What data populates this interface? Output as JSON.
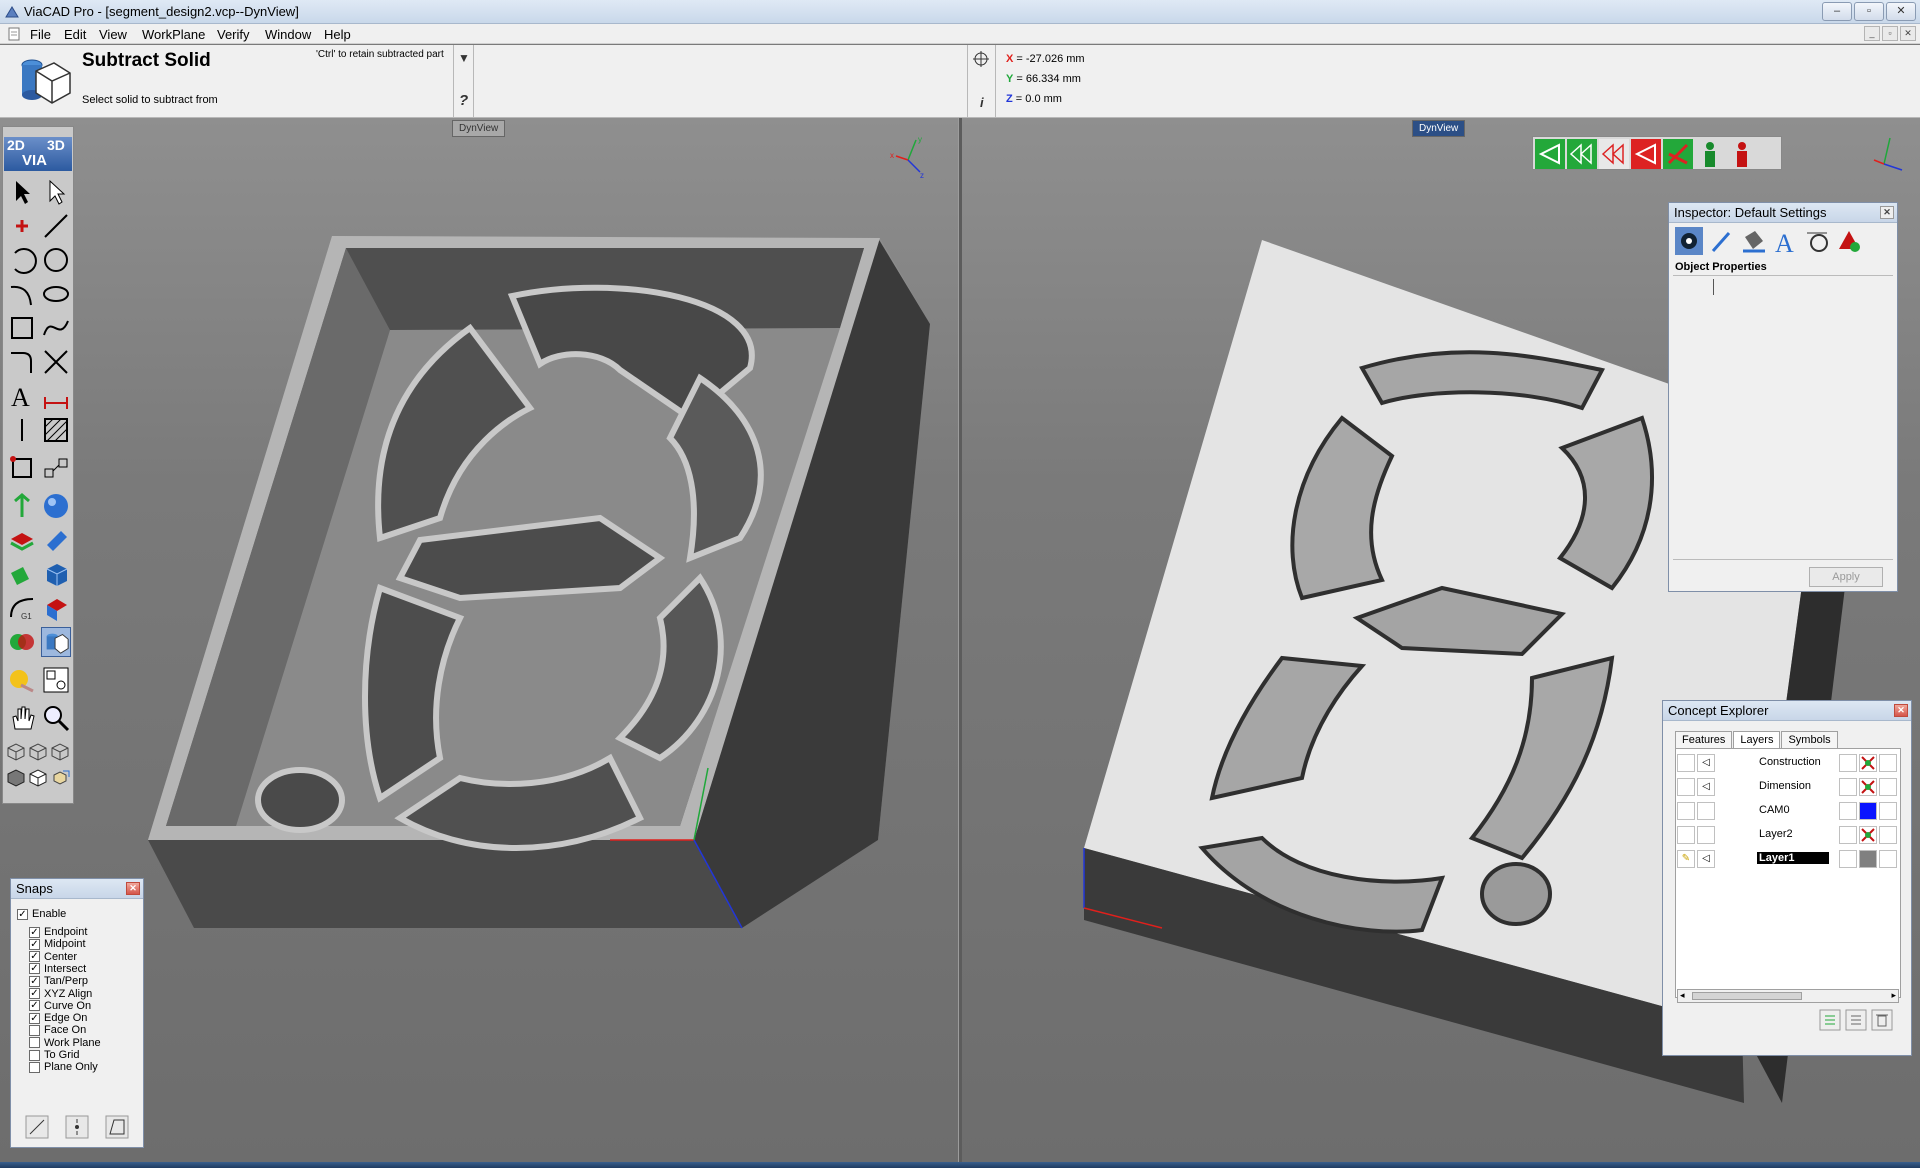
{
  "app": {
    "title": "ViaCAD Pro - [segment_design2.vcp--DynView]",
    "window_buttons": [
      "–",
      "▫",
      "✕"
    ],
    "mdi_buttons": [
      "_",
      "▫",
      "✕"
    ]
  },
  "menu": [
    "File",
    "Edit",
    "View",
    "WorkPlane",
    "Verify",
    "Window",
    "Help"
  ],
  "command": {
    "title": "Subtract Solid",
    "prompt": "Select solid to subtract from",
    "hint": "'Ctrl' to retain subtracted part",
    "dropdown": "▼",
    "help": "?"
  },
  "coords": {
    "x_label": "X",
    "x": "= -27.026 mm",
    "y_label": "Y",
    "y": "= 66.334 mm",
    "z_label": "Z",
    "z": "= 0.0 mm",
    "info": "i"
  },
  "viewports": {
    "left_label": "DynView",
    "right_label": "DynView"
  },
  "toolbox": {
    "brand_2d": "2D",
    "brand_3d": "3D",
    "brand_via": "VIA"
  },
  "snaps": {
    "title": "Snaps",
    "enable_label": "Enable",
    "enable_checked": true,
    "items": [
      {
        "label": "Endpoint",
        "checked": true
      },
      {
        "label": "Midpoint",
        "checked": true
      },
      {
        "label": "Center",
        "checked": true
      },
      {
        "label": "Intersect",
        "checked": true
      },
      {
        "label": "Tan/Perp",
        "checked": true
      },
      {
        "label": "XYZ Align",
        "checked": true
      },
      {
        "label": "Curve On",
        "checked": true
      },
      {
        "label": "Edge On",
        "checked": true
      },
      {
        "label": "Face On",
        "checked": false
      },
      {
        "label": "Work Plane",
        "checked": false
      },
      {
        "label": "To Grid",
        "checked": false
      },
      {
        "label": "Plane Only",
        "checked": false
      }
    ]
  },
  "inspector": {
    "title": "Inspector: Default Settings",
    "section": "Object Properties",
    "apply_label": "Apply"
  },
  "concept_explorer": {
    "title": "Concept Explorer",
    "tabs": [
      "Features",
      "Layers",
      "Symbols"
    ],
    "active_tab": "Layers",
    "layers": [
      {
        "name": "Construction",
        "color": "multi",
        "active": false
      },
      {
        "name": "Dimension",
        "color": "multi",
        "active": false
      },
      {
        "name": "CAM0",
        "color": "#0a14ff",
        "active": false
      },
      {
        "name": "Layer2",
        "color": "multi",
        "active": false
      },
      {
        "name": "Layer1",
        "color": "#808080",
        "active": true
      }
    ]
  },
  "colors": {
    "accent": "#2c5aa0",
    "x_axis": "#e0201c",
    "y_axis": "#1fa83a",
    "z_axis": "#2236d8",
    "viewbg": "#7a7a7a",
    "solid_light": "#e4e4e4",
    "solid_dark": "#3a3a3a"
  }
}
